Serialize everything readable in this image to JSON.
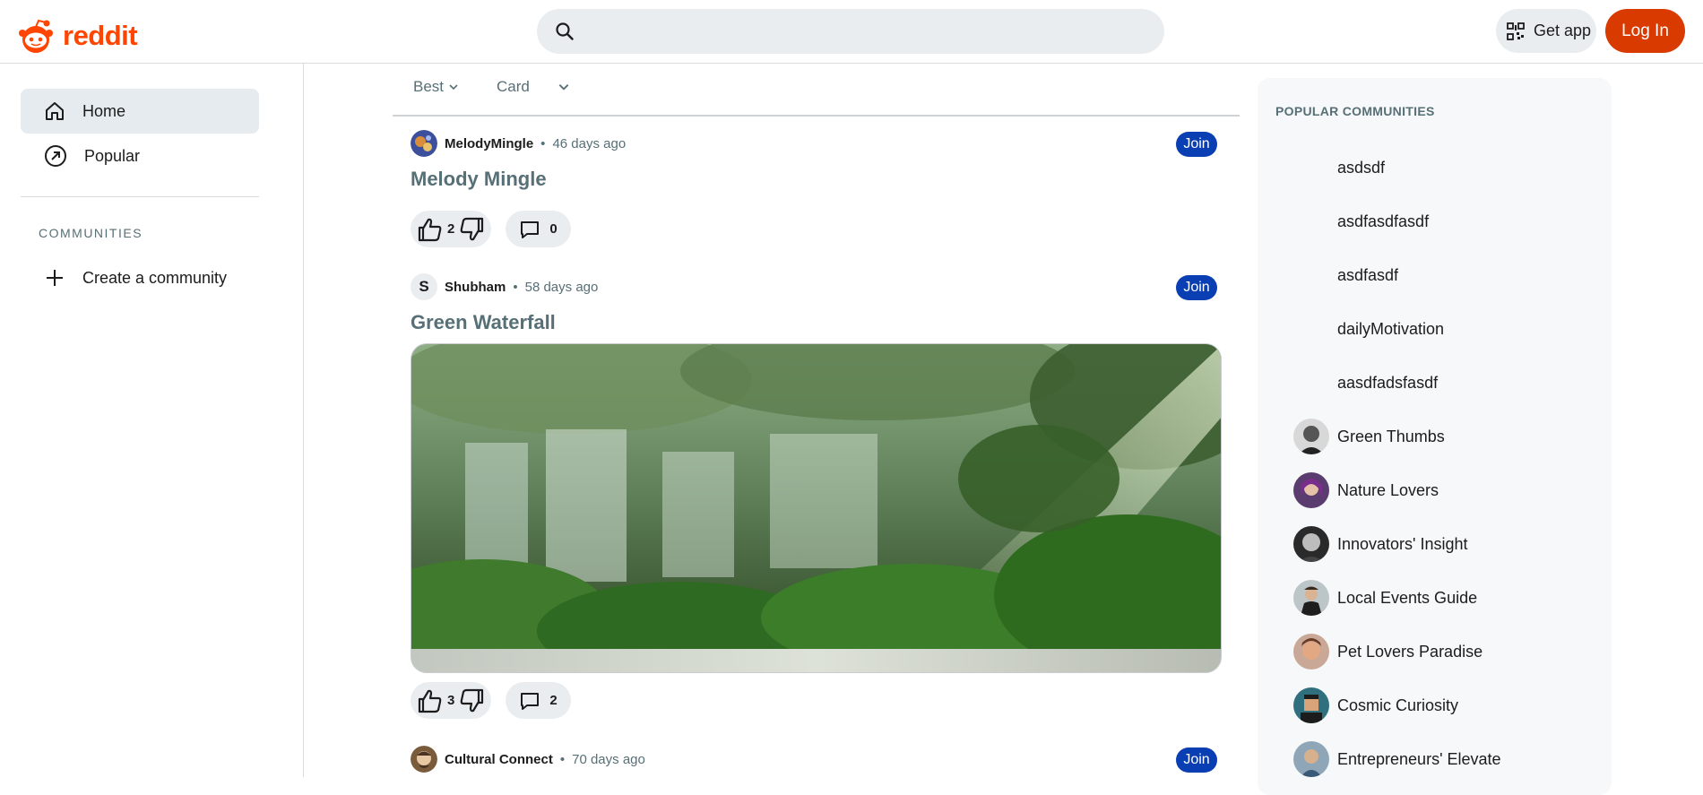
{
  "header": {
    "logo_text": "reddit",
    "search_placeholder": "",
    "get_app_label": "Get app",
    "login_label": "Log In",
    "brand_color": "#ff4500",
    "login_color": "#d93a00"
  },
  "sidebar": {
    "items": [
      {
        "label": "Home",
        "icon": "home-icon",
        "active": true
      },
      {
        "label": "Popular",
        "icon": "popular-icon",
        "active": false
      }
    ],
    "communities_label": "COMMUNITIES",
    "create_label": "Create a community"
  },
  "feed": {
    "sort_label": "Best",
    "view_label": "Card",
    "posts": [
      {
        "author": "MelodyMingle",
        "time": "46 days ago",
        "title": "Melody Mingle",
        "votes": "2",
        "comments": "0",
        "join_label": "Join",
        "has_image": false
      },
      {
        "author": "Shubham",
        "avatar_letter": "S",
        "time": "58 days ago",
        "title": "Green Waterfall",
        "votes": "3",
        "comments": "2",
        "join_label": "Join",
        "has_image": true
      },
      {
        "author": "Cultural Connect",
        "time": "70 days ago",
        "join_label": "Join"
      }
    ]
  },
  "popular": {
    "title": "POPULAR COMMUNITIES",
    "items": [
      {
        "name": "asdsdf"
      },
      {
        "name": "asdfasdfasdf"
      },
      {
        "name": "asdfasdf"
      },
      {
        "name": "dailyMotivation"
      },
      {
        "name": "aasdfadsfasdf"
      },
      {
        "name": "Green Thumbs"
      },
      {
        "name": "Nature Lovers"
      },
      {
        "name": "Innovators' Insight"
      },
      {
        "name": "Local Events Guide"
      },
      {
        "name": "Pet Lovers Paradise"
      },
      {
        "name": "Cosmic Curiosity"
      },
      {
        "name": "Entrepreneurs' Elevate"
      }
    ]
  }
}
